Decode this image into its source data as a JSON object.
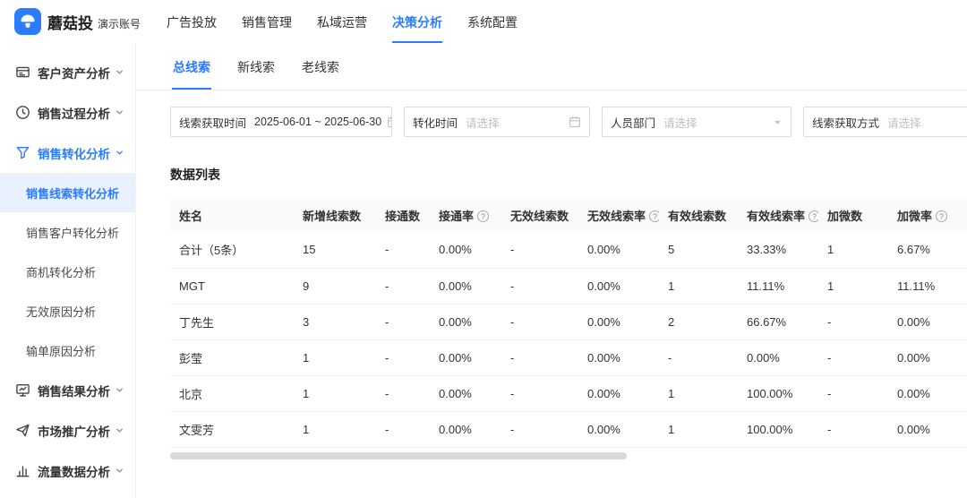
{
  "brand": {
    "name": "蘑菇投",
    "account": "演示账号",
    "primary_color": "#2b7cff"
  },
  "top_nav": [
    {
      "label": "广告投放",
      "active": false
    },
    {
      "label": "销售管理",
      "active": false
    },
    {
      "label": "私域运营",
      "active": false
    },
    {
      "label": "决策分析",
      "active": true
    },
    {
      "label": "系统配置",
      "active": false
    }
  ],
  "sidebar": {
    "items": [
      {
        "label": "客户资产分析",
        "icon": "asset",
        "active": false,
        "children": []
      },
      {
        "label": "销售过程分析",
        "icon": "process",
        "active": false,
        "children": []
      },
      {
        "label": "销售转化分析",
        "icon": "conversion",
        "active": true,
        "expanded": true,
        "children": [
          {
            "label": "销售线索转化分析",
            "active": true
          },
          {
            "label": "销售客户转化分析",
            "active": false
          },
          {
            "label": "商机转化分析",
            "active": false
          },
          {
            "label": "无效原因分析",
            "active": false
          },
          {
            "label": "输单原因分析",
            "active": false
          }
        ]
      },
      {
        "label": "销售结果分析",
        "icon": "result",
        "active": false,
        "children": []
      },
      {
        "label": "市场推广分析",
        "icon": "promotion",
        "active": false,
        "children": []
      },
      {
        "label": "流量数据分析",
        "icon": "traffic",
        "active": false,
        "children": []
      }
    ]
  },
  "tabs": [
    {
      "label": "总线索",
      "active": true
    },
    {
      "label": "新线索",
      "active": false
    },
    {
      "label": "老线索",
      "active": false
    }
  ],
  "filters": [
    {
      "name": "lead-time-range",
      "label": "线索获取时间",
      "value": "2025-06-01 ~ 2025-06-30",
      "placeholder": "",
      "icon": "calendar"
    },
    {
      "name": "conversion-time",
      "label": "转化时间",
      "value": "",
      "placeholder": "请选择",
      "icon": "calendar"
    },
    {
      "name": "department",
      "label": "人员部门",
      "value": "",
      "placeholder": "请选择",
      "icon": "chevron-down"
    },
    {
      "name": "lead-source",
      "label": "线索获取方式",
      "value": "",
      "placeholder": "请选择",
      "icon": "chevron-down"
    }
  ],
  "section": {
    "title": "数据列表"
  },
  "table": {
    "help_glyph": "?",
    "columns": [
      {
        "label": "姓名",
        "help": false
      },
      {
        "label": "新增线索数",
        "help": false
      },
      {
        "label": "接通数",
        "help": false
      },
      {
        "label": "接通率",
        "help": true
      },
      {
        "label": "无效线索数",
        "help": false
      },
      {
        "label": "无效线索率",
        "help": true
      },
      {
        "label": "有效线索数",
        "help": false
      },
      {
        "label": "有效线索率",
        "help": true
      },
      {
        "label": "加微数",
        "help": false
      },
      {
        "label": "加微率",
        "help": true
      }
    ],
    "rows": [
      [
        "合计（5条）",
        "15",
        "-",
        "0.00%",
        "-",
        "0.00%",
        "5",
        "33.33%",
        "1",
        "6.67%"
      ],
      [
        "MGT",
        "9",
        "-",
        "0.00%",
        "-",
        "0.00%",
        "1",
        "11.11%",
        "1",
        "11.11%"
      ],
      [
        "丁先生",
        "3",
        "-",
        "0.00%",
        "-",
        "0.00%",
        "2",
        "66.67%",
        "-",
        "0.00%"
      ],
      [
        "彭莹",
        "1",
        "-",
        "0.00%",
        "-",
        "0.00%",
        "-",
        "0.00%",
        "-",
        "0.00%"
      ],
      [
        "北京",
        "1",
        "-",
        "0.00%",
        "-",
        "0.00%",
        "1",
        "100.00%",
        "-",
        "0.00%"
      ],
      [
        "文雯芳",
        "1",
        "-",
        "0.00%",
        "-",
        "0.00%",
        "1",
        "100.00%",
        "-",
        "0.00%"
      ]
    ]
  }
}
